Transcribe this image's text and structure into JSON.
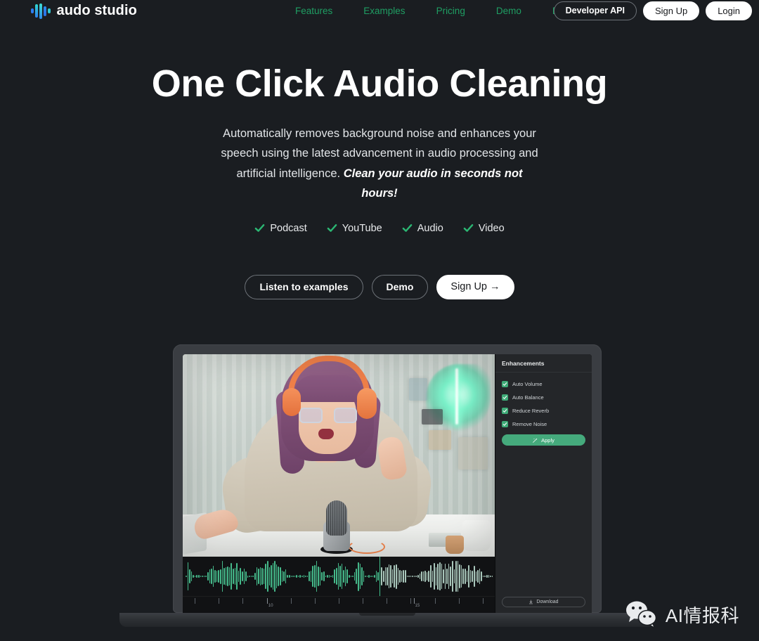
{
  "brand": {
    "name": "audo studio",
    "logo_icon": "audio-bars-logo"
  },
  "nav": {
    "links": [
      {
        "label": "Features"
      },
      {
        "label": "Examples"
      },
      {
        "label": "Pricing"
      },
      {
        "label": "Demo"
      },
      {
        "label": "Blog"
      }
    ],
    "actions": [
      {
        "label": "Developer API",
        "style": "outline"
      },
      {
        "label": "Sign Up",
        "style": "white"
      },
      {
        "label": "Login",
        "style": "white"
      }
    ],
    "link_color": "#1f9e63"
  },
  "hero": {
    "title": "One Click Audio Cleaning",
    "subtitle_plain": "Automatically removes background noise and enhances your speech using the latest advancement in audio processing and artificial intelligence. ",
    "subtitle_emphasis": "Clean your audio in seconds not hours!",
    "features": [
      {
        "label": "Podcast",
        "icon": "check-icon"
      },
      {
        "label": "YouTube",
        "icon": "check-icon"
      },
      {
        "label": "Audio",
        "icon": "check-icon"
      },
      {
        "label": "Video",
        "icon": "check-icon"
      }
    ],
    "check_color": "#2bb673",
    "buttons": [
      {
        "label": "Listen to examples",
        "style": "outline"
      },
      {
        "label": "Demo",
        "style": "outline"
      },
      {
        "label": "Sign Up →",
        "style": "white"
      }
    ]
  },
  "app": {
    "panel_title": "Enhancements",
    "options": [
      {
        "label": "Auto Volume",
        "checked": true
      },
      {
        "label": "Auto Balance",
        "checked": true
      },
      {
        "label": "Reduce Reverb",
        "checked": true
      },
      {
        "label": "Remove Noise",
        "checked": true
      }
    ],
    "apply_label": "Apply",
    "apply_icon": "magic-wand-icon",
    "download_label": "Download",
    "download_icon": "download-icon",
    "accent_color": "#45aa7c",
    "timeline": {
      "labels": [
        {
          "value": "10",
          "pos": 0.27
        },
        {
          "value": "15",
          "pos": 0.74
        }
      ],
      "tick_count": 13,
      "playhead_pos": 0.63
    },
    "photo_alt": "woman with purple hair and orange headphones speaking into a studio microphone"
  },
  "watermark": {
    "text": "AI情报科",
    "icon": "wechat-icon"
  }
}
